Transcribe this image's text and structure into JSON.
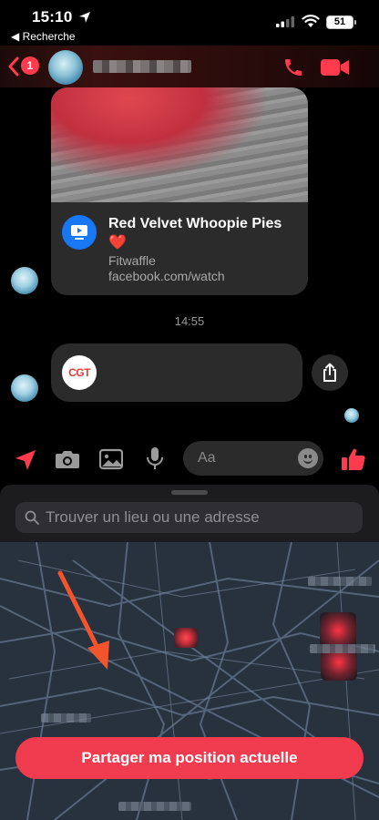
{
  "status_bar": {
    "time": "15:10",
    "back_app_label": "◀ Recherche",
    "battery": "51"
  },
  "header": {
    "unread_count": "1",
    "accent_color": "#ff3b4d"
  },
  "shared_link": {
    "title": "Red Velvet Whoopie Pies",
    "emoji": "❤️",
    "source": "Fitwaffle",
    "domain": "facebook.com/watch"
  },
  "conversation": {
    "timestamp": "14:55",
    "cgt_logo_text": "CGT"
  },
  "composer": {
    "placeholder": "Aa"
  },
  "location_sheet": {
    "search_placeholder": "Trouver un lieu ou une adresse",
    "share_button_label": "Partager ma position actuelle",
    "button_color": "#f13b4f"
  }
}
